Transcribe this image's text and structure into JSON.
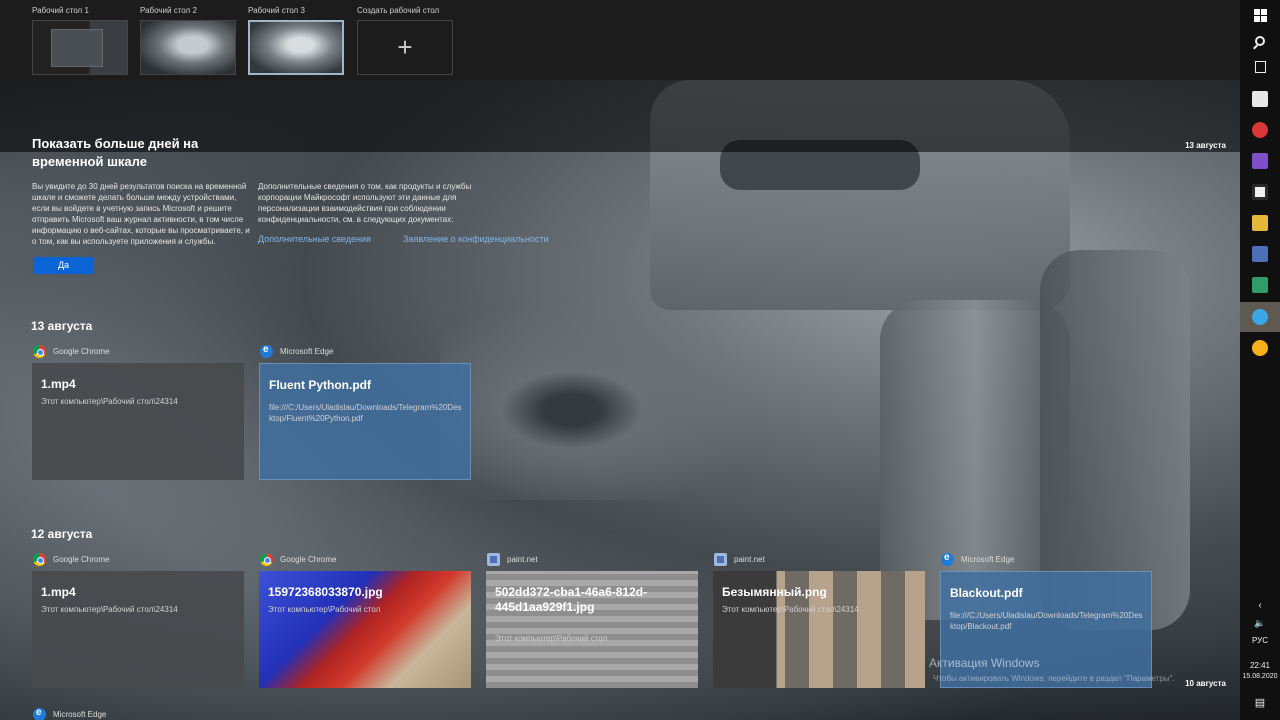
{
  "desktops": {
    "items": [
      {
        "label": "Рабочий стол 1"
      },
      {
        "label": "Рабочий стол 2"
      },
      {
        "label": "Рабочий стол 3"
      }
    ],
    "new_label": "Создать рабочий стол",
    "new_symbol": "+"
  },
  "banner": {
    "title": "Показать больше дней на временной шкале",
    "text_left": "Вы увидите до 30 дней результатов поиска на временной шкале и сможете делать больше между устройствами, если вы войдете в учетную запись Microsoft и решите отправить Microsoft ваш журнал активности, в том числе информацию о веб-сайтах, которые вы просматриваете, и о том, как вы используете приложения и службы.",
    "text_right": "Дополнительные сведения о том, как продукты и службы корпорации Майкрософт используют эти данные для персонализации взаимодействия при соблюдении конфиденциальности, см. в следующих документах:",
    "link_more": "Дополнительные сведения",
    "link_privacy": "Заявление о конфиденциальности",
    "yes_button": "Да"
  },
  "timeline": {
    "date_right_top": "13 августа",
    "date_right_bottom": "10 августа",
    "day1": {
      "heading": "13 августа",
      "cards": [
        {
          "app": "Google Chrome",
          "title": "1.mp4",
          "subtitle": "Этот компьютер\\Рабочий стол\\24314"
        },
        {
          "app": "Microsoft Edge",
          "title": "Fluent Python.pdf",
          "subtitle": "file:///C:/Users/Uladislau/Downloads/Telegram%20Desktop/Fluent%20Python.pdf"
        }
      ]
    },
    "day2": {
      "heading": "12 августа",
      "cards": [
        {
          "app": "Google Chrome",
          "title": "1.mp4",
          "subtitle": "Этот компьютер\\Рабочий стол\\24314"
        },
        {
          "app": "Google Chrome",
          "title": "15972368033870.jpg",
          "subtitle": "Этот компьютер\\Рабочий стол"
        },
        {
          "app": "paint.net",
          "title": "502dd372-cba1-46a6-812d-445d1aa929f1.jpg",
          "subtitle": "Этот компьютер\\Рабочий стол"
        },
        {
          "app": "paint.net",
          "title": "Безымянный.png",
          "subtitle": "Этот компьютер\\Рабочий стол\\24314"
        },
        {
          "app": "Microsoft Edge",
          "title": "Blackout.pdf",
          "subtitle": "file:///C:/Users/Uladislau/Downloads/Telegram%20Desktop/Blackout.pdf"
        }
      ]
    },
    "day3_app": "Microsoft Edge"
  },
  "watermark": {
    "line1": "Активация Windows",
    "line2": "Чтобы активировать Windows, перейдите в раздел \"Параметры\"."
  },
  "taskbar": {
    "icons": [
      "windows-start-icon",
      "search-icon",
      "task-view-icon",
      "app-icon-1",
      "app-icon-2",
      "visual-studio-icon",
      "app-icon-3",
      "file-explorer-icon",
      "app-icon-4",
      "app-icon-5",
      "telegram-icon",
      "app-icon-6"
    ],
    "language": "РУС",
    "time": "22:41",
    "date": "15.08.2020"
  },
  "colors": {
    "accent": "#0a64d6",
    "link": "#7fb6e8",
    "blue_card": "#3f6ea0",
    "gray_card": "#484a4d"
  }
}
